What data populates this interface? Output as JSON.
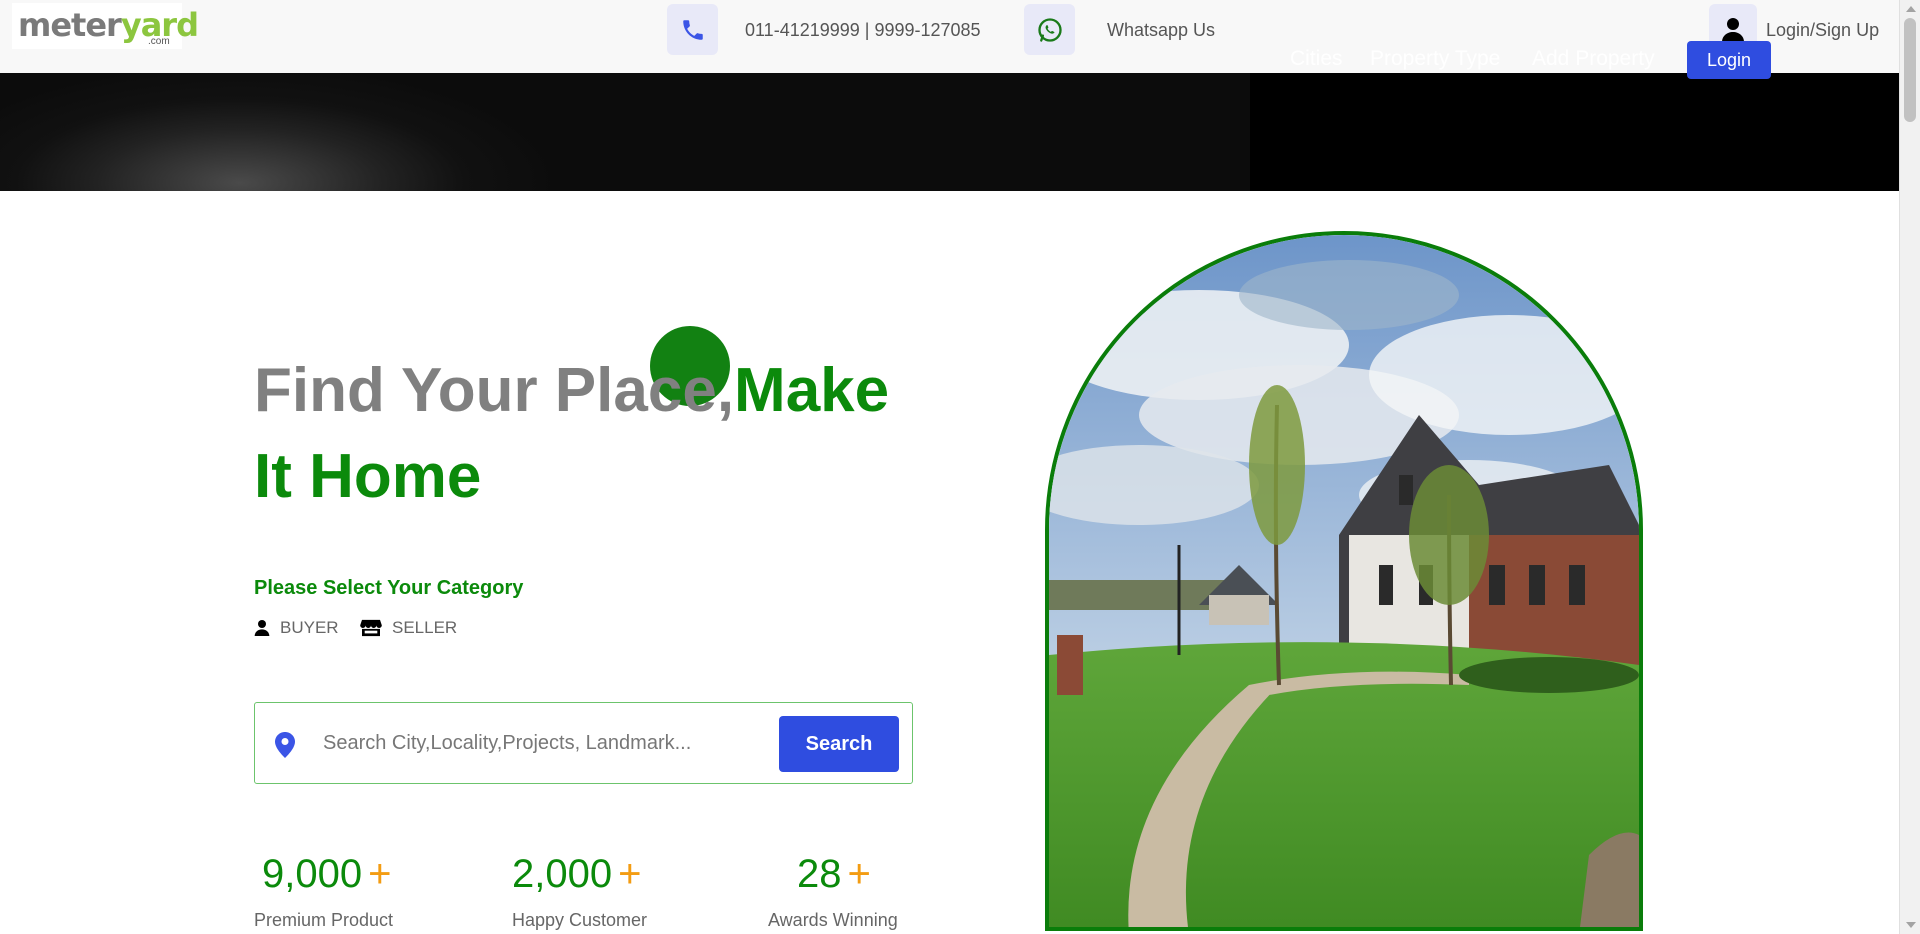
{
  "topbar": {
    "logo_main_a": "meter",
    "logo_main_b": "yard",
    "logo_sub": ".com",
    "phone_icon": "phone-icon",
    "phone_text": "011-41219999 | 9999-127085",
    "whatsapp_icon": "whatsapp-icon",
    "whatsapp_text": "Whatsapp Us",
    "user_icon": "user-icon",
    "login_signup": "Login/Sign Up"
  },
  "nav": {
    "cities": "Cities",
    "property_type": "Property Type",
    "add_property": "Add Property",
    "login": "Login"
  },
  "hero": {
    "title_grey": "Find Your Place,",
    "title_green": "Make It Home",
    "category_title": "Please Select Your Category",
    "categories": [
      {
        "label": "BUYER",
        "icon": "user-icon"
      },
      {
        "label": "SELLER",
        "icon": "store-icon"
      }
    ],
    "search_placeholder": "Search City,Locality,Projects, Landmark...",
    "search_button": "Search",
    "search_icon": "location-pin-icon"
  },
  "stats": [
    {
      "value": "9,000",
      "suffix": "+",
      "label": "Premium Product"
    },
    {
      "value": "2,000",
      "suffix": "+",
      "label": "Happy Customer"
    },
    {
      "value": "28",
      "suffix": "+",
      "label": "Awards Winning"
    }
  ],
  "colors": {
    "brand_green": "#0b8a0b",
    "accent_blue": "#2f4de0",
    "accent_orange": "#f39c12",
    "logo_green": "#8cc63f"
  }
}
